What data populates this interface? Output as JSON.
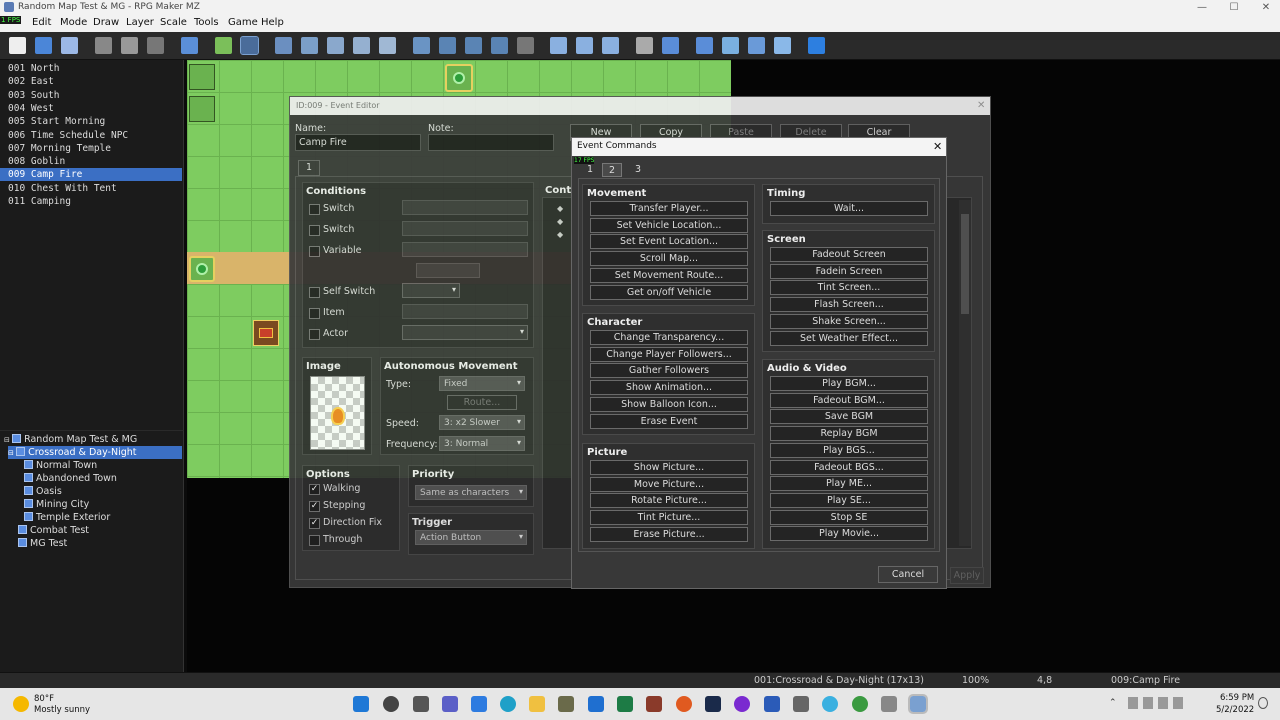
{
  "window": {
    "title": "Random Map Test & MG - RPG Maker MZ"
  },
  "menu": [
    "Edit",
    "Mode",
    "Draw",
    "Layer",
    "Scale",
    "Tools",
    "Game",
    "Help"
  ],
  "fps": [
    "1 FPS",
    "17 FPS"
  ],
  "events": [
    {
      "id": "001",
      "name": "North"
    },
    {
      "id": "002",
      "name": "East"
    },
    {
      "id": "003",
      "name": "South"
    },
    {
      "id": "004",
      "name": "West"
    },
    {
      "id": "005",
      "name": "Start Morning"
    },
    {
      "id": "006",
      "name": "Time Schedule NPC"
    },
    {
      "id": "007",
      "name": "Morning Temple"
    },
    {
      "id": "008",
      "name": "Goblin"
    },
    {
      "id": "009",
      "name": "Camp Fire"
    },
    {
      "id": "010",
      "name": "Chest With Tent"
    },
    {
      "id": "011",
      "name": "Camping"
    }
  ],
  "maptree": {
    "root": "Random Map Test & MG",
    "items": [
      "Crossroad & Day-Night",
      "Normal Town",
      "Abandoned Town",
      "Oasis",
      "Mining City",
      "Temple Exterior",
      "Combat Test",
      "MG Test"
    ]
  },
  "editor": {
    "title": "ID:009 - Event Editor",
    "name_label": "Name:",
    "name_value": "Camp Fire",
    "note_label": "Note:",
    "buttons": {
      "new": "New",
      "copy": "Copy",
      "paste": "Paste",
      "delete": "Delete",
      "clear": "Clear"
    },
    "page_tab": "1",
    "contents_label": "Conte",
    "conditions": {
      "title": "Conditions",
      "switch1": "Switch",
      "switch2": "Switch",
      "variable": "Variable",
      "self_switch": "Self Switch",
      "item": "Item",
      "actor": "Actor"
    },
    "image_title": "Image",
    "autonomous": {
      "title": "Autonomous Movement",
      "type_label": "Type:",
      "type_value": "Fixed",
      "route": "Route...",
      "speed_label": "Speed:",
      "speed_value": "3: x2 Slower",
      "freq_label": "Frequency:",
      "freq_value": "3: Normal"
    },
    "options": {
      "title": "Options",
      "walking": "Walking",
      "stepping": "Stepping",
      "direction_fix": "Direction Fix",
      "through": "Through"
    },
    "priority": {
      "title": "Priority",
      "value": "Same as characters"
    },
    "trigger": {
      "title": "Trigger",
      "value": "Action Button"
    },
    "apply": "Apply"
  },
  "commands": {
    "title": "Event Commands",
    "tabs": [
      "1",
      "2",
      "3"
    ],
    "movement": {
      "title": "Movement",
      "items": [
        "Transfer Player...",
        "Set Vehicle Location...",
        "Set Event Location...",
        "Scroll Map...",
        "Set Movement Route...",
        "Get on/off Vehicle"
      ]
    },
    "character": {
      "title": "Character",
      "items": [
        "Change Transparency...",
        "Change Player Followers...",
        "Gather Followers",
        "Show Animation...",
        "Show Balloon Icon...",
        "Erase Event"
      ]
    },
    "picture": {
      "title": "Picture",
      "items": [
        "Show Picture...",
        "Move Picture...",
        "Rotate Picture...",
        "Tint Picture...",
        "Erase Picture..."
      ]
    },
    "timing": {
      "title": "Timing",
      "items": [
        "Wait..."
      ]
    },
    "screen": {
      "title": "Screen",
      "items": [
        "Fadeout Screen",
        "Fadein Screen",
        "Tint Screen...",
        "Flash Screen...",
        "Shake Screen...",
        "Set Weather Effect..."
      ]
    },
    "audio": {
      "title": "Audio & Video",
      "items": [
        "Play BGM...",
        "Fadeout BGM...",
        "Save BGM",
        "Replay BGM",
        "Play BGS...",
        "Fadeout BGS...",
        "Play ME...",
        "Play SE...",
        "Stop SE",
        "Play Movie..."
      ]
    },
    "cancel": "Cancel"
  },
  "status": {
    "map": "001:Crossroad & Day-Night (17x13)",
    "zoom": "100%",
    "coords": "4,8",
    "event": "009:Camp Fire"
  },
  "taskbar": {
    "temp": "80°F",
    "weather": "Mostly sunny",
    "time": "6:59 PM",
    "date": "5/2/2022"
  }
}
